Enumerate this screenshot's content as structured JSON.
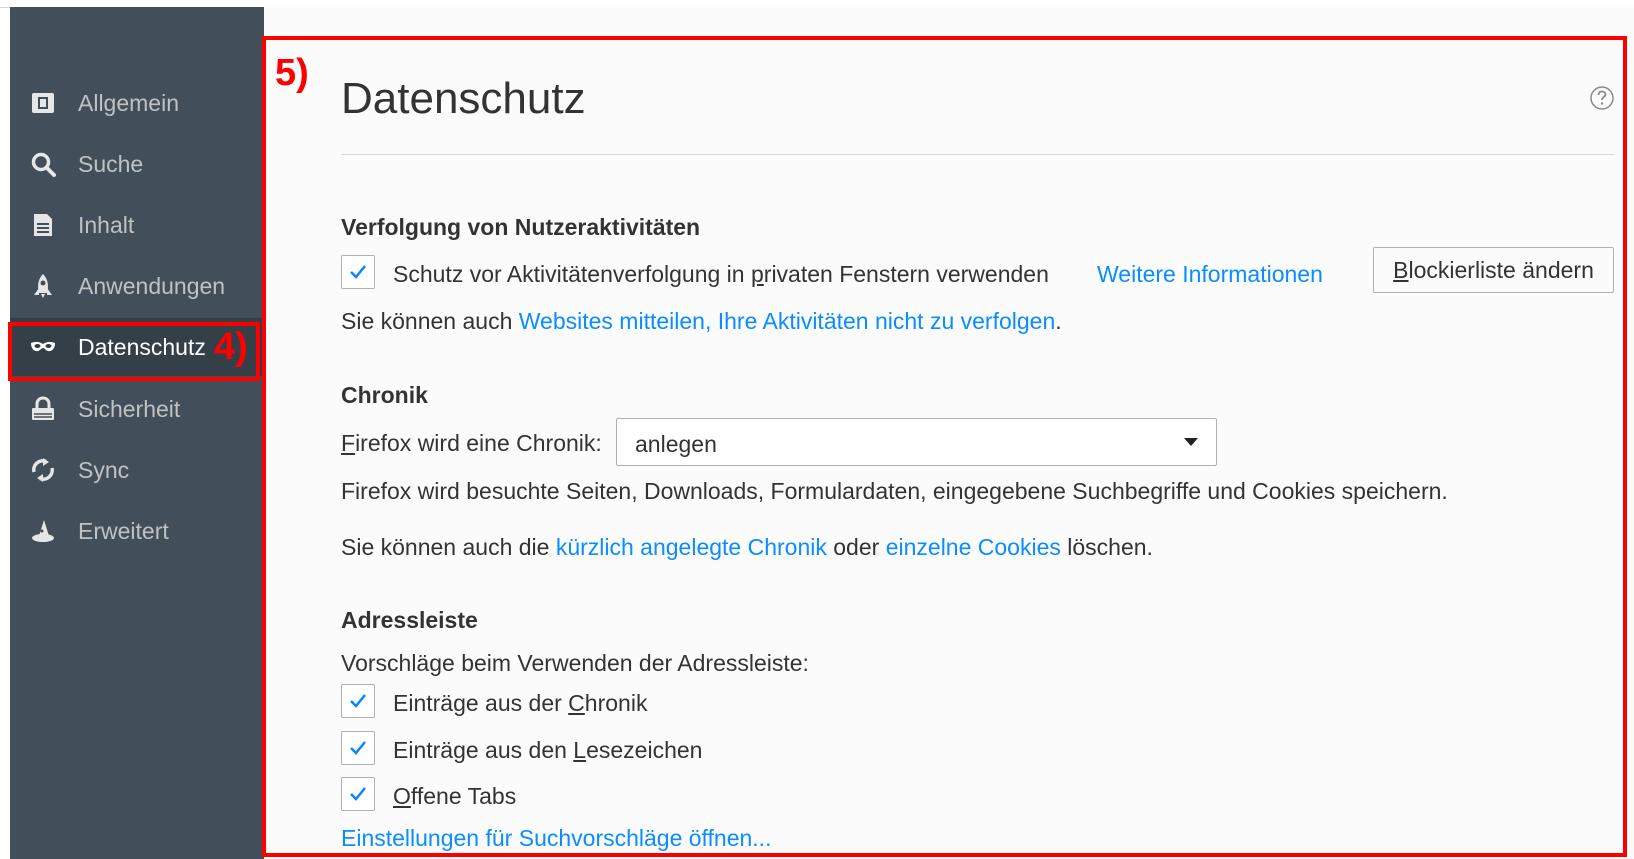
{
  "sidebar": {
    "items": [
      {
        "label": "Allgemein",
        "icon": "general-icon"
      },
      {
        "label": "Suche",
        "icon": "search-icon"
      },
      {
        "label": "Inhalt",
        "icon": "document-icon"
      },
      {
        "label": "Anwendungen",
        "icon": "rocket-icon"
      },
      {
        "label": "Datenschutz",
        "icon": "mask-icon"
      },
      {
        "label": "Sicherheit",
        "icon": "lock-icon"
      },
      {
        "label": "Sync",
        "icon": "sync-icon"
      },
      {
        "label": "Erweitert",
        "icon": "wizard-hat-icon"
      }
    ],
    "active_index": 4
  },
  "annotations": {
    "sidebar_marker": "4)",
    "main_marker": "5)"
  },
  "main": {
    "title": "Datenschutz",
    "tracking": {
      "heading": "Verfolgung von Nutzeraktivitäten",
      "checkbox_label_pre": "Schutz vor Aktivitätenverfolgung in ",
      "checkbox_label_access": "p",
      "checkbox_label_post": "rivaten Fenstern verwenden",
      "checked": true,
      "more_info_link": "Weitere Informationen",
      "blocklist_access": "B",
      "blocklist_rest": "lockierliste ändern",
      "dnt_pre": "Sie können auch ",
      "dnt_link": "Websites mitteilen, Ihre Aktivitäten nicht zu verfolgen",
      "dnt_post": "."
    },
    "history": {
      "heading": "Chronik",
      "select_label_access": "F",
      "select_label_rest": "irefox wird eine Chronik:",
      "select_value": "anlegen",
      "description": "Firefox wird besuchte Seiten, Downloads, Formulardaten, eingegebene Suchbegriffe und Cookies speichern.",
      "clear_pre": "Sie können auch die ",
      "clear_link1": "kürzlich angelegte Chronik",
      "clear_mid": " oder ",
      "clear_link2": "einzelne Cookies",
      "clear_post": " löschen."
    },
    "addressbar": {
      "heading": "Adressleiste",
      "intro": "Vorschläge beim Verwenden der Adressleiste:",
      "options": [
        {
          "pre": "Einträge aus der ",
          "access": "C",
          "post": "hronik",
          "checked": true
        },
        {
          "pre": "Einträge aus den ",
          "access": "L",
          "post": "esezeichen",
          "checked": true
        },
        {
          "pre": "",
          "access": "O",
          "post": "ffene Tabs",
          "checked": true
        }
      ],
      "suggest_link": "Einstellungen für Suchvorschläge öffnen..."
    }
  },
  "colors": {
    "sidebar_bg": "#424f5a",
    "link": "#0a8dff",
    "annotation": "#ff0000",
    "checkmark": "#0a84ff"
  }
}
